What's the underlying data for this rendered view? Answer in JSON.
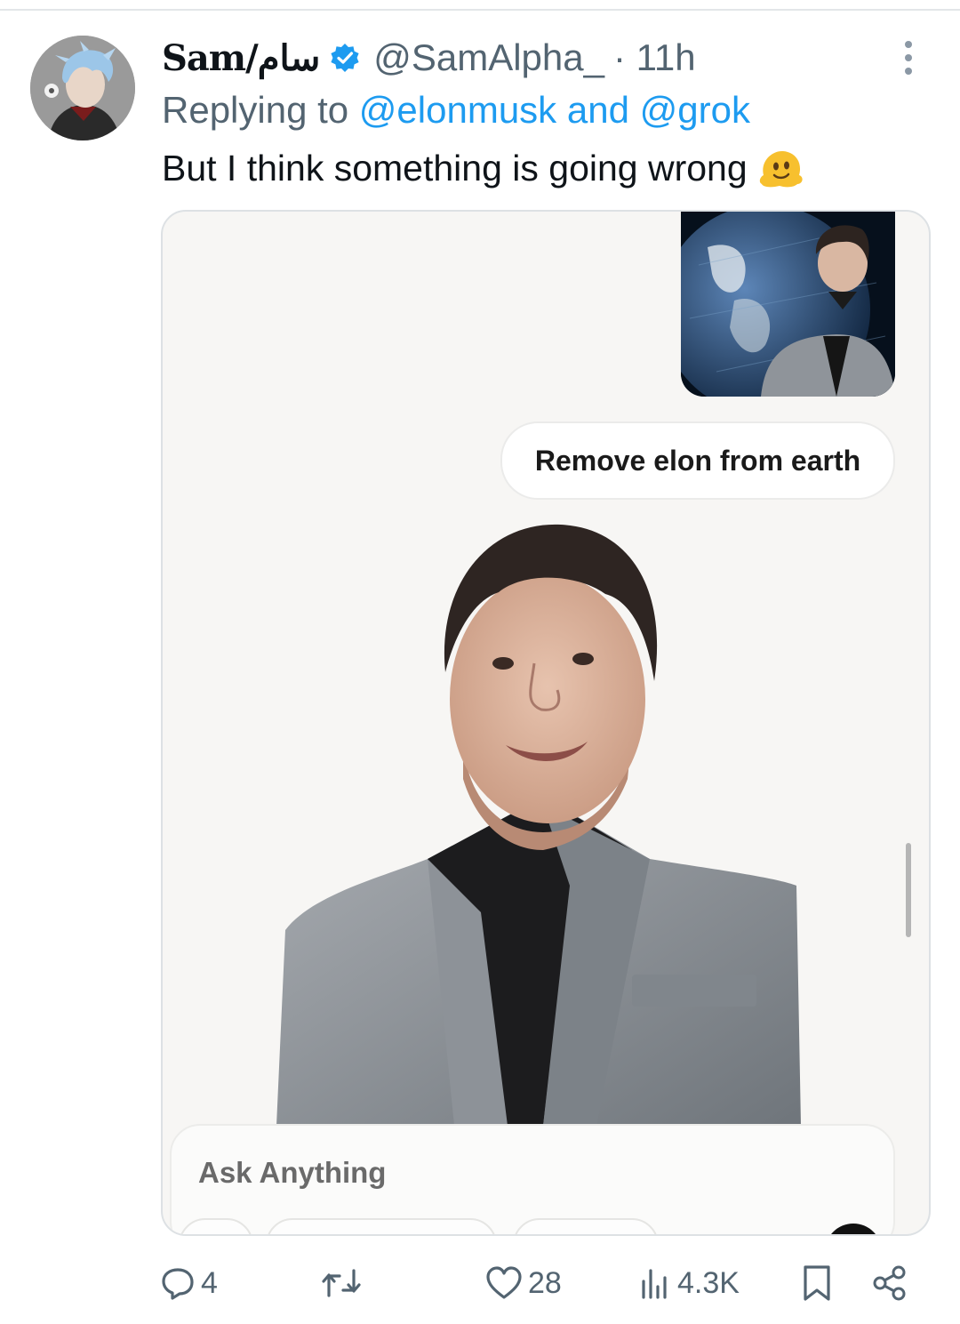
{
  "tweet": {
    "display_name": "Sam/سام",
    "handle": "@SamAlpha_",
    "time": "· 11h",
    "replying_prefix": "Replying to",
    "mention_1": "@elonmusk",
    "mention_join": "and",
    "mention_2": "@grok",
    "text": "But I think something is going wrong",
    "emoji": "melting-face-emoji"
  },
  "media": {
    "prompt": "Remove elon from earth",
    "input_placeholder": "Ask Anything"
  },
  "actions": {
    "replies": "4",
    "likes": "28",
    "views": "4.3K"
  },
  "colors": {
    "link": "#1d9bf0",
    "secondary_text": "#536471",
    "verified": "#1d9bf0"
  }
}
